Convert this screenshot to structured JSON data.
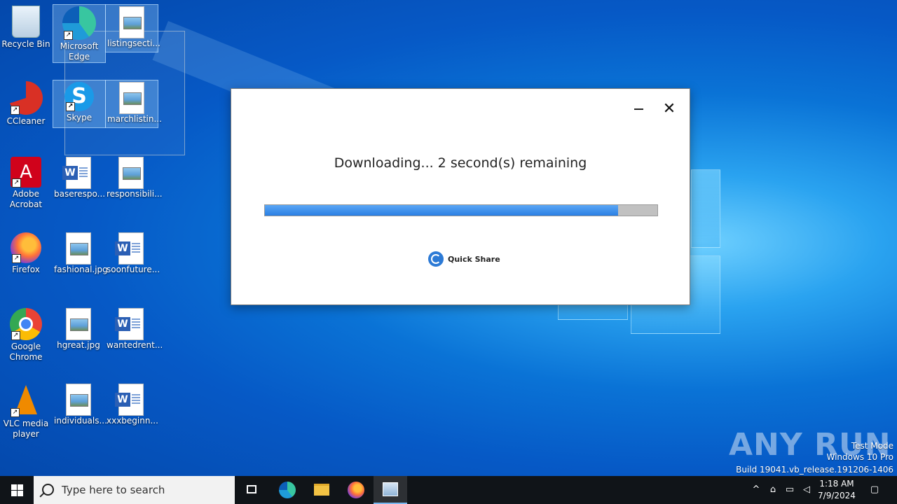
{
  "desktop": {
    "icons": [
      {
        "label": "Recycle Bin"
      },
      {
        "label": "Microsoft Edge"
      },
      {
        "label": "listingsecti..."
      },
      {
        "label": "CCleaner"
      },
      {
        "label": "Skype"
      },
      {
        "label": "marchlistin..."
      },
      {
        "label": "Adobe Acrobat"
      },
      {
        "label": "baserespo..."
      },
      {
        "label": "responsibili..."
      },
      {
        "label": "Firefox"
      },
      {
        "label": "fashional.jpg"
      },
      {
        "label": "soonfuture..."
      },
      {
        "label": "Google Chrome"
      },
      {
        "label": "hgreat.jpg"
      },
      {
        "label": "wantedrent..."
      },
      {
        "label": "VLC media player"
      },
      {
        "label": "individuals..."
      },
      {
        "label": "xxxbeginn..."
      }
    ]
  },
  "dialog": {
    "status_text": "Downloading... 2 second(s) remaining",
    "progress_fraction": 0.9,
    "brand_label": "Quick Share",
    "minimize_icon": "minimize-icon",
    "close_icon": "close-icon"
  },
  "watermark": {
    "brand": "ANY RUN",
    "line1": "Test Mode",
    "line2": "Windows 10 Pro",
    "line3": "Build 19041.vb_release.191206-1406"
  },
  "taskbar": {
    "search_placeholder": "Type here to search",
    "time": "1:18 AM",
    "date": "7/9/2024"
  },
  "colors": {
    "progress_fill": "#2a7fe3",
    "taskbar_bg": "#101418",
    "accent": "#0a73d6"
  }
}
